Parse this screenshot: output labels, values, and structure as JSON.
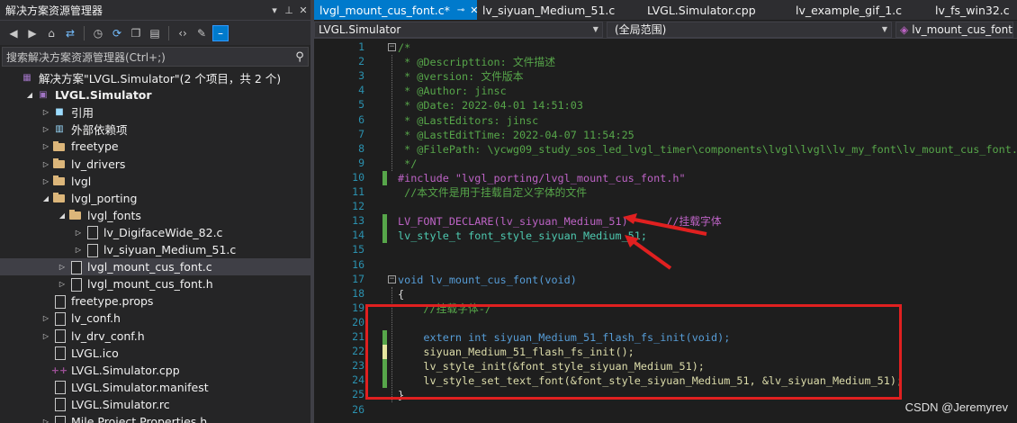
{
  "solution_explorer": {
    "title": "解决方案资源管理器",
    "title_buttons": [
      "▾",
      "⊥",
      "✕"
    ],
    "search_placeholder": "搜索解决方案资源管理器(Ctrl+;)",
    "search_icon": "search-icon",
    "tree": [
      {
        "label": "解决方案\"LVGL.Simulator\"(2 个项目，共 2 个)",
        "icon": "solution-icon",
        "arrow": "",
        "indent": 0
      },
      {
        "label": "LVGL.Simulator",
        "icon": "project-icon",
        "arrow": "◢",
        "indent": 1,
        "bold": true
      },
      {
        "label": "引用",
        "icon": "references-icon",
        "arrow": "▷",
        "indent": 2
      },
      {
        "label": "外部依赖项",
        "icon": "external-deps-icon",
        "arrow": "▷",
        "indent": 2
      },
      {
        "label": "freetype",
        "icon": "folder-icon",
        "arrow": "▷",
        "indent": 2
      },
      {
        "label": "lv_drivers",
        "icon": "folder-icon",
        "arrow": "▷",
        "indent": 2
      },
      {
        "label": "lvgl",
        "icon": "folder-icon",
        "arrow": "▷",
        "indent": 2
      },
      {
        "label": "lvgl_porting",
        "icon": "folder-icon",
        "arrow": "◢",
        "indent": 2
      },
      {
        "label": "lvgl_fonts",
        "icon": "folder-icon",
        "arrow": "◢",
        "indent": 3
      },
      {
        "label": "lv_DigifaceWide_82.c",
        "icon": "file-icon",
        "arrow": "▷",
        "indent": 4
      },
      {
        "label": "lv_siyuan_Medium_51.c",
        "icon": "file-icon",
        "arrow": "▷",
        "indent": 4
      },
      {
        "label": "lvgl_mount_cus_font.c",
        "icon": "file-icon",
        "arrow": "▷",
        "indent": 3,
        "selected": true
      },
      {
        "label": "lvgl_mount_cus_font.h",
        "icon": "file-icon",
        "arrow": "▷",
        "indent": 3
      },
      {
        "label": "freetype.props",
        "icon": "file-icon",
        "arrow": "",
        "indent": 2
      },
      {
        "label": "lv_conf.h",
        "icon": "file-icon",
        "arrow": "▷",
        "indent": 2
      },
      {
        "label": "lv_drv_conf.h",
        "icon": "file-icon",
        "arrow": "▷",
        "indent": 2
      },
      {
        "label": "LVGL.ico",
        "icon": "image-icon",
        "arrow": "",
        "indent": 2
      },
      {
        "label": "LVGL.Simulator.cpp",
        "icon": "cpp-icon",
        "arrow": "",
        "indent": 2
      },
      {
        "label": "LVGL.Simulator.manifest",
        "icon": "file-icon",
        "arrow": "",
        "indent": 2
      },
      {
        "label": "LVGL.Simulator.rc",
        "icon": "file-icon",
        "arrow": "",
        "indent": 2
      },
      {
        "label": "Mile.Project.Properties.h",
        "icon": "file-icon",
        "arrow": "▷",
        "indent": 2
      }
    ]
  },
  "editor": {
    "tabs": [
      {
        "label": "lvgl_mount_cus_font.c*",
        "active": true,
        "pin": "⊸",
        "close": "✕"
      },
      {
        "label": "lv_siyuan_Medium_51.c",
        "active": false
      },
      {
        "label": "LVGL.Simulator.cpp",
        "active": false
      },
      {
        "label": "lv_example_gif_1.c",
        "active": false
      },
      {
        "label": "lv_fs_win32.c",
        "active": false
      }
    ],
    "nav": {
      "project": "LVGL.Simulator",
      "scope": "(全局范围)",
      "member": "lv_mount_cus_font(vo"
    },
    "line_numbers": [
      "1",
      "2",
      "3",
      "4",
      "5",
      "6",
      "7",
      "8",
      "9",
      "10",
      "11",
      "12",
      "13",
      "14",
      "15",
      "16",
      "17",
      "18",
      "19",
      "20",
      "21",
      "22",
      "23",
      "24",
      "25",
      "26"
    ],
    "lines": [
      "/*",
      " * @Descripttion: 文件描述",
      " * @version: 文件版本",
      " * @Author: jinsc",
      " * @Date: 2022-04-01 14:51:03",
      " * @LastEditors: jinsc",
      " * @LastEditTime: 2022-04-07 11:54:25",
      " * @FilePath: \\ycwg09_study_sos_led_lvgl_timer\\components\\lvgl\\lvgl\\lv_my_font\\lv_mount_cus_font.c",
      " */",
      "#include \"lvgl_porting/lvgl_mount_cus_font.h\"",
      " //本文件是用于挂载自定义字体的文件",
      "",
      "LV_FONT_DECLARE(lv_siyuan_Medium_51)      //挂载字体",
      "lv_style_t font_style_siyuan_Medium_51;",
      "",
      "",
      "void lv_mount_cus_font(void)",
      "{",
      "    //挂载字体-/",
      "",
      "    extern int siyuan_Medium_51_flash_fs_init(void);",
      "    siyuan_Medium_51_flash_fs_init();",
      "    lv_style_init(&font_style_siyuan_Medium_51);",
      "    lv_style_set_text_font(&font_style_siyuan_Medium_51, &lv_siyuan_Medium_51);",
      "}",
      ""
    ]
  },
  "watermark": "CSDN @Jeremyrev",
  "colors": {
    "accent": "#007acc",
    "annotation_red": "#e02020",
    "comment": "#57a64a",
    "keyword": "#569cd6"
  }
}
